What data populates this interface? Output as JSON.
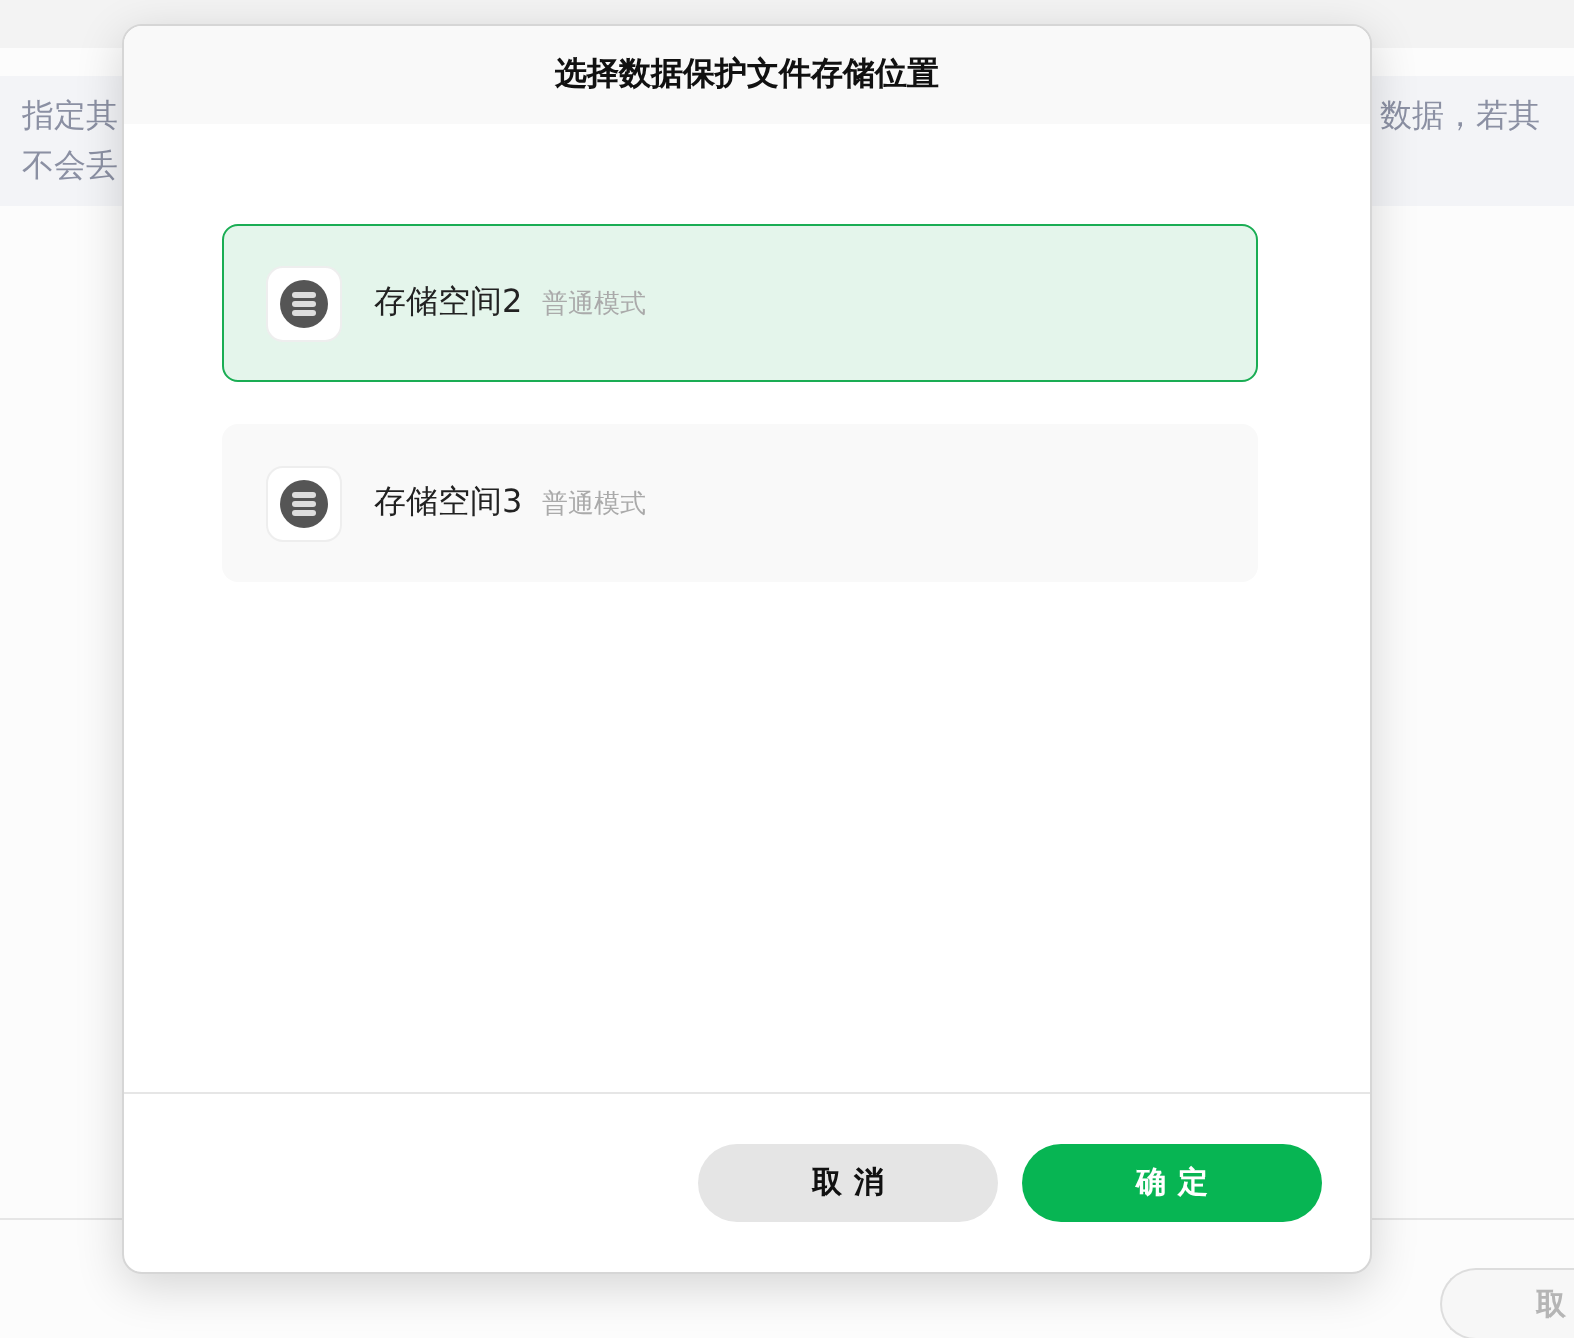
{
  "background": {
    "notice": {
      "lines": [
        {
          "left": "指定其",
          "right": "数据，若其"
        },
        {
          "left": "不会丢"
        }
      ]
    },
    "footer_button": "取"
  },
  "dialog": {
    "title": "选择数据保护文件存储位置",
    "locations": [
      {
        "name": "存储空间2",
        "mode": "普通模式",
        "selected": true
      },
      {
        "name": "存储空间3",
        "mode": "普通模式",
        "selected": false
      }
    ],
    "buttons": [
      {
        "label": "取消",
        "kind": "secondary"
      },
      {
        "label": "确定",
        "kind": "primary"
      }
    ]
  }
}
